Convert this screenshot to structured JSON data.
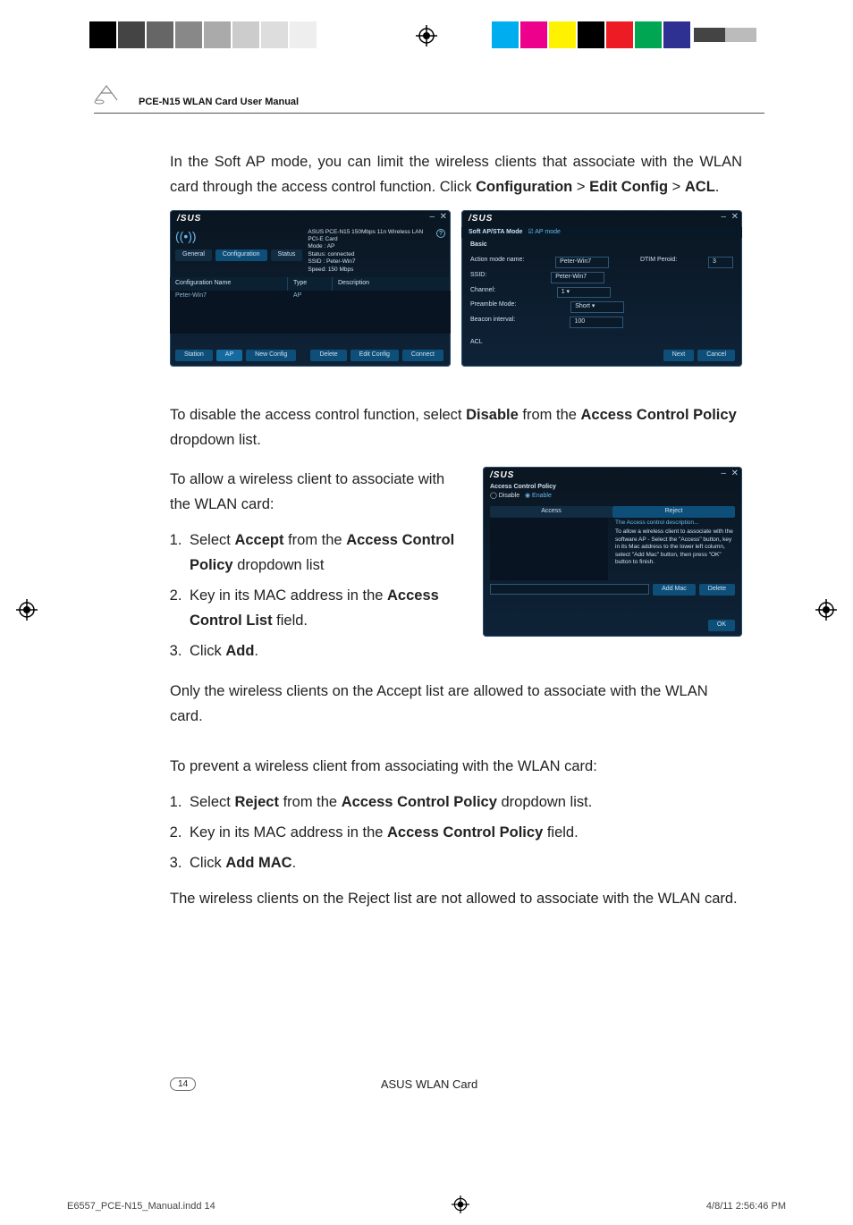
{
  "header": {
    "manual_title": "PCE-N15 WLAN Card User Manual"
  },
  "para1": {
    "pre": "In the Soft AP mode, you can limit the wireless clients that associate with the WLAN card through the access control function. Click ",
    "b1": "Configuration",
    "gt1": " > ",
    "b2": "Edit Config",
    "gt2": " > ",
    "b3": "ACL",
    "end": "."
  },
  "shotA": {
    "brand": "/SUS",
    "tabs": {
      "general": "General",
      "configuration": "Configuration",
      "status": "Status"
    },
    "info": {
      "device": "ASUS PCE-N15 150Mbps 11n Wireless LAN PCI-E Card",
      "mode": "Mode : AP",
      "status": "Status: connected",
      "ssid": "SSID : Peter-Win7",
      "speed": "Speed: 150 Mbps"
    },
    "table": {
      "h1": "Configuration Name",
      "h2": "Type",
      "h3": "Description",
      "row_name": "Peter-Win7",
      "row_type": "AP"
    },
    "buttons": {
      "station": "Station",
      "ap": "AP",
      "new_config": "New Config",
      "delete": "Delete",
      "edit_config": "Edit Config",
      "connect": "Connect"
    }
  },
  "shotB": {
    "brand": "/SUS",
    "mode_label": "Soft AP/STA Mode",
    "mode_check": "AP mode",
    "section": "Basic",
    "fields": {
      "action_label": "Action mode name:",
      "action_val": "Peter-Win7",
      "dtim_label": "DTIM Peroid:",
      "dtim_val": "3",
      "ssid_label": "SSID:",
      "ssid_val": "Peter-Win7",
      "channel_label": "Channel:",
      "channel_val": "1",
      "preamble_label": "Preamble Mode:",
      "preamble_val": "Short",
      "beacon_label": "Beacon interval:",
      "beacon_val": "100"
    },
    "acl": "ACL",
    "buttons": {
      "next": "Next",
      "cancel": "Cancel"
    }
  },
  "para2": {
    "pre": "To disable the access control function, select ",
    "b1": "Disable",
    "mid": " from the ",
    "b2": "Access Control Policy",
    "end": " dropdown list."
  },
  "allow": {
    "intro": "To allow a wireless client to associate with the WLAN card:",
    "l1a": "Select ",
    "l1b": "Accept",
    "l1c": " from the ",
    "l1d": "Access Control Policy",
    "l1e": " dropdown list",
    "l2a": "Key in its MAC address in the ",
    "l2b": "Access Control List",
    "l2c": " field.",
    "l3a": "Click ",
    "l3b": "Add",
    "l3c": "."
  },
  "shotC": {
    "brand": "/SUS",
    "title": "Access Control Policy",
    "radios": {
      "disable": "Disable",
      "enable": "Enable"
    },
    "tabs": {
      "access": "Access",
      "reject": "Reject"
    },
    "desc_head": "The Access control description...",
    "desc": "To allow a wireless client to associate with the software AP - Select the \"Access\" button, key in its Mac address to the lower left column, select \"Add Mac\" button, then press \"OK\" button to finish.",
    "add_mac": "Add Mac",
    "delete": "Delete",
    "ok": "OK"
  },
  "after_allow": "Only the wireless clients on the Accept list are allowed to associate with the WLAN card.",
  "prevent": {
    "intro": "To prevent a wireless client from associating with the WLAN card:",
    "l1a": "Select ",
    "l1b": "Reject",
    "l1c": " from the ",
    "l1d": "Access Control Policy",
    "l1e": " dropdown list.",
    "l2a": "Key in its MAC address in the ",
    "l2b": "Access Control Policy",
    "l2c": " field.",
    "l3a": "Click ",
    "l3b": "Add MAC",
    "l3c": "."
  },
  "after_prevent": "The wireless clients on the Reject list are not allowed to associate with the WLAN card.",
  "footer": {
    "page_num": "14",
    "center": "ASUS WLAN Card",
    "indd": "E6557_PCE-N15_Manual.indd   14",
    "ts": "4/8/11   2:56:46 PM"
  }
}
